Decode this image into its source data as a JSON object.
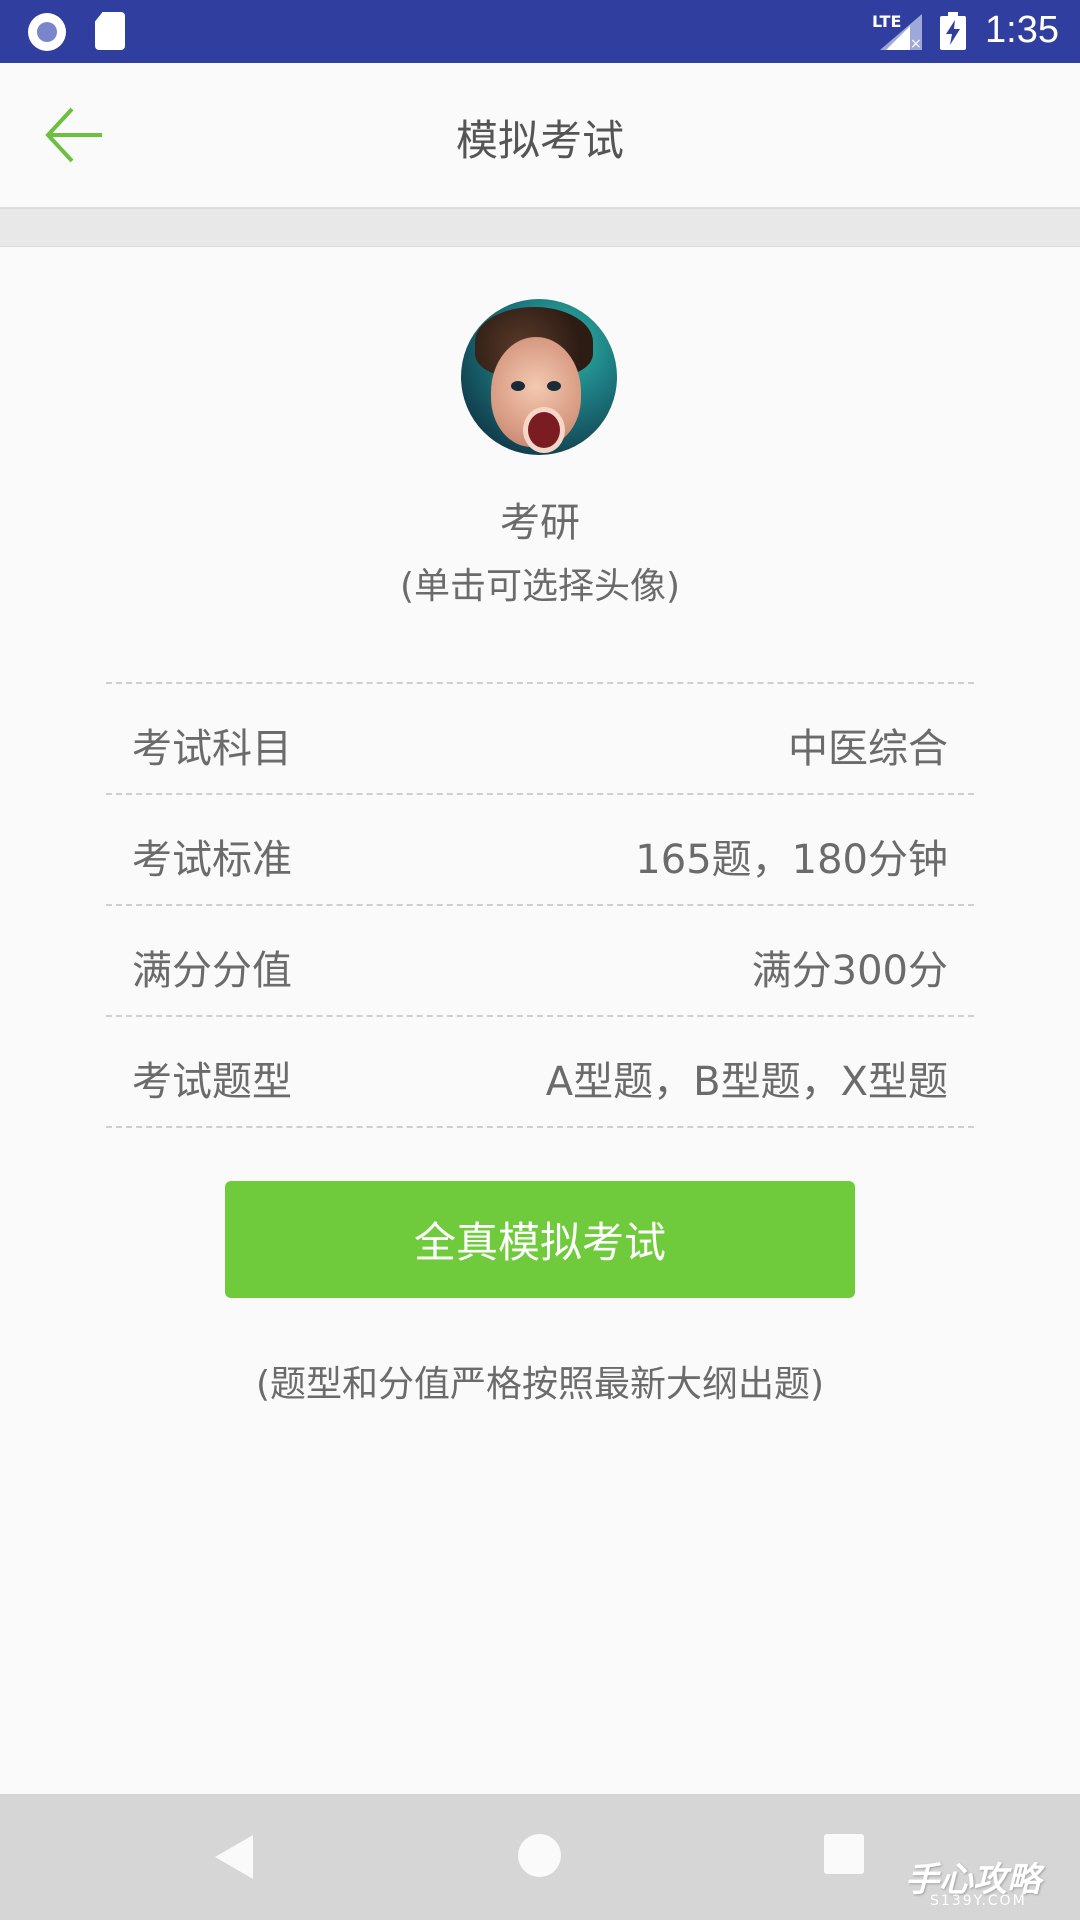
{
  "status_bar": {
    "network": "LTE",
    "time": "1:35"
  },
  "app_bar": {
    "title": "模拟考试"
  },
  "profile": {
    "name": "考研",
    "hint": "(单击可选择头像)"
  },
  "info_rows": [
    {
      "label": "考试科目",
      "value": "中医综合"
    },
    {
      "label": "考试标准",
      "value": "165题，180分钟"
    },
    {
      "label": "满分分值",
      "value": "满分300分"
    },
    {
      "label": "考试题型",
      "value": "A型题，B型题，X型题"
    }
  ],
  "start_button": {
    "label": "全真模拟考试"
  },
  "footer_note": "(题型和分值严格按照最新大纲出题)",
  "watermark": {
    "main": "手心攻略",
    "sub": "S139Y.COM"
  },
  "colors": {
    "status_bar": "#303f9f",
    "accent_green": "#6fcb3b",
    "back_arrow": "#6cbf3f",
    "text_gray": "#6b6b6b",
    "nav_bar": "#d6d6d6"
  }
}
